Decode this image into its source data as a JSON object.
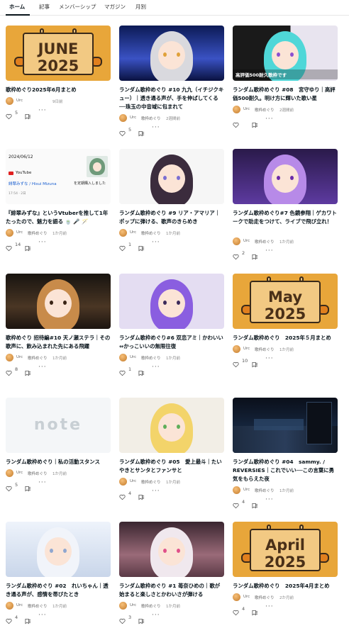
{
  "tabs": [
    {
      "label": "ホーム"
    },
    {
      "label": "記事"
    },
    {
      "label": "メンバーシップ"
    },
    {
      "label": "マガジン"
    },
    {
      "label": "月別"
    }
  ],
  "articles": [
    {
      "title": "歌枠めぐり2025年6月まとめ",
      "author": "Urc",
      "magazine": "",
      "time": "9日前",
      "likes": "5",
      "thumb": "banner",
      "banner_line1": "JUNE",
      "banner_line2": "2025"
    },
    {
      "title": "ランダム歌枠めぐり #10 九九（イチジクキュー）｜透き通る声が、手を伸ばしてくる──珠玉の中音域に包まれて",
      "author": "Urc",
      "magazine": "歌枠めぐり",
      "time": "2週間前",
      "likes": "5",
      "thumb": "silver-hair"
    },
    {
      "title": "ランダム歌枠めぐり #08　宮守ゆり｜高評価500耐久。明け方に輝いた歌い星",
      "author": "Urc",
      "magazine": "歌枠めぐり",
      "time": "2週間前",
      "likes": "",
      "thumb": "cyan-hair",
      "caption": "高評価500耐久歌枠です"
    },
    {
      "title": "『緋翠みずな』というVtuberを推して1年たったので、魅力を語る 🍵 🎤 🪄",
      "author": "Urc",
      "magazine": "歌枠めぐり",
      "time": "1か月前",
      "likes": "14",
      "thumb": "screenshot",
      "shot_date": "2024/06/12",
      "shot_source": "YouTube",
      "shot_link": "緋翠みずな / Hisui Mizuna",
      "shot_text": "を定期購入しました",
      "shot_time": "17:54 · 2日"
    },
    {
      "title": "ランダム歌枠めぐり #9 リア・アマリア｜ポップに弾ける、歌声のきらめき",
      "author": "Urc",
      "magazine": "歌枠めぐり",
      "time": "1か月前",
      "likes": "1",
      "thumb": "crown-girl"
    },
    {
      "title": "ランダム歌枠めぐり#7 色鏡参翔｜ゲカワトークで助走をつけて、ライブで飛び立れ！",
      "author": "Urc",
      "magazine": "歌枠めぐり",
      "time": "1か月前",
      "likes": "2",
      "thumb": "purple-demon"
    },
    {
      "title": "歌枠めぐり 招待編#10 天ノ瀬ステラ｜その歌声に、飲み込まれた先にある飛躍",
      "author": "Urc",
      "magazine": "歌枠めぐり",
      "time": "1か月前",
      "likes": "8",
      "thumb": "bear-ears"
    },
    {
      "title": "ランダム歌枠めぐり#6 双恋アミ｜かわいい⇔かっこいいの無限往復",
      "author": "Urc",
      "magazine": "歌枠めぐり",
      "time": "1か月前",
      "likes": "1",
      "thumb": "purple-boy"
    },
    {
      "title": "ランダム歌枠めぐり　2025年５月まとめ",
      "author": "Urc",
      "magazine": "歌枠めぐり",
      "time": "1か月前",
      "likes": "10",
      "thumb": "banner",
      "banner_line1": "May",
      "banner_line2": "2025"
    },
    {
      "title": "ランダム歌枠めぐり｜私の活動スタンス",
      "author": "Urc",
      "magazine": "歌枠めぐり",
      "time": "1か月前",
      "likes": "5",
      "thumb": "note",
      "logo": "note"
    },
    {
      "title": "ランダム歌枠めぐり #05　愛上最斗｜たいやきとサンタとファンサと",
      "author": "Urc",
      "magazine": "歌枠めぐり",
      "time": "1か月前",
      "likes": "4",
      "thumb": "blonde"
    },
    {
      "title": "ランダム歌枠めぐり #04　sammy. / REVERSIES｜これでいい──この言葉に勇気をもらえた夜",
      "author": "Urc",
      "magazine": "歌枠めぐり",
      "time": "1か月前",
      "likes": "4",
      "thumb": "studio"
    },
    {
      "title": "ランダム歌枠めぐり #02　れいちゃん｜透き通る声が、感情を帯びたとき",
      "author": "Urc",
      "magazine": "歌枠めぐり",
      "time": "1か月前",
      "likes": "4",
      "thumb": "white-hair"
    },
    {
      "title": "ランダム歌枠めぐり #1 苺奈ひめの｜歌が始まると楽しさとかわいさが弾ける",
      "author": "Urc",
      "magazine": "歌枠めぐり",
      "time": "1か月前",
      "likes": "3",
      "thumb": "pink-room"
    },
    {
      "title": "ランダム歌枠めぐり　2025年4月まとめ",
      "author": "Urc",
      "magazine": "歌枠めぐり",
      "time": "2か月前",
      "likes": "4",
      "thumb": "banner",
      "banner_line1": "April",
      "banner_line2": "2025"
    }
  ]
}
